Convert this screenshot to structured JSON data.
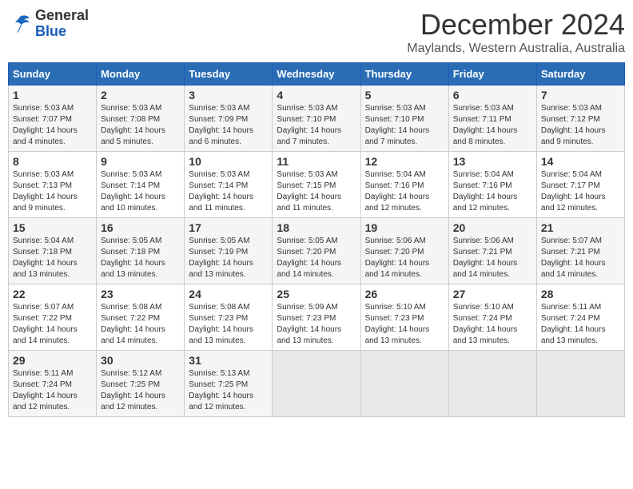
{
  "header": {
    "logo_line1": "General",
    "logo_line2": "Blue",
    "month": "December 2024",
    "location": "Maylands, Western Australia, Australia"
  },
  "weekdays": [
    "Sunday",
    "Monday",
    "Tuesday",
    "Wednesday",
    "Thursday",
    "Friday",
    "Saturday"
  ],
  "weeks": [
    [
      {
        "day": "1",
        "sunrise": "5:03 AM",
        "sunset": "7:07 PM",
        "daylight": "14 hours and 4 minutes."
      },
      {
        "day": "2",
        "sunrise": "5:03 AM",
        "sunset": "7:08 PM",
        "daylight": "14 hours and 5 minutes."
      },
      {
        "day": "3",
        "sunrise": "5:03 AM",
        "sunset": "7:09 PM",
        "daylight": "14 hours and 6 minutes."
      },
      {
        "day": "4",
        "sunrise": "5:03 AM",
        "sunset": "7:10 PM",
        "daylight": "14 hours and 7 minutes."
      },
      {
        "day": "5",
        "sunrise": "5:03 AM",
        "sunset": "7:10 PM",
        "daylight": "14 hours and 7 minutes."
      },
      {
        "day": "6",
        "sunrise": "5:03 AM",
        "sunset": "7:11 PM",
        "daylight": "14 hours and 8 minutes."
      },
      {
        "day": "7",
        "sunrise": "5:03 AM",
        "sunset": "7:12 PM",
        "daylight": "14 hours and 9 minutes."
      }
    ],
    [
      {
        "day": "8",
        "sunrise": "5:03 AM",
        "sunset": "7:13 PM",
        "daylight": "14 hours and 9 minutes."
      },
      {
        "day": "9",
        "sunrise": "5:03 AM",
        "sunset": "7:14 PM",
        "daylight": "14 hours and 10 minutes."
      },
      {
        "day": "10",
        "sunrise": "5:03 AM",
        "sunset": "7:14 PM",
        "daylight": "14 hours and 11 minutes."
      },
      {
        "day": "11",
        "sunrise": "5:03 AM",
        "sunset": "7:15 PM",
        "daylight": "14 hours and 11 minutes."
      },
      {
        "day": "12",
        "sunrise": "5:04 AM",
        "sunset": "7:16 PM",
        "daylight": "14 hours and 12 minutes."
      },
      {
        "day": "13",
        "sunrise": "5:04 AM",
        "sunset": "7:16 PM",
        "daylight": "14 hours and 12 minutes."
      },
      {
        "day": "14",
        "sunrise": "5:04 AM",
        "sunset": "7:17 PM",
        "daylight": "14 hours and 12 minutes."
      }
    ],
    [
      {
        "day": "15",
        "sunrise": "5:04 AM",
        "sunset": "7:18 PM",
        "daylight": "14 hours and 13 minutes."
      },
      {
        "day": "16",
        "sunrise": "5:05 AM",
        "sunset": "7:18 PM",
        "daylight": "14 hours and 13 minutes."
      },
      {
        "day": "17",
        "sunrise": "5:05 AM",
        "sunset": "7:19 PM",
        "daylight": "14 hours and 13 minutes."
      },
      {
        "day": "18",
        "sunrise": "5:05 AM",
        "sunset": "7:20 PM",
        "daylight": "14 hours and 14 minutes."
      },
      {
        "day": "19",
        "sunrise": "5:06 AM",
        "sunset": "7:20 PM",
        "daylight": "14 hours and 14 minutes."
      },
      {
        "day": "20",
        "sunrise": "5:06 AM",
        "sunset": "7:21 PM",
        "daylight": "14 hours and 14 minutes."
      },
      {
        "day": "21",
        "sunrise": "5:07 AM",
        "sunset": "7:21 PM",
        "daylight": "14 hours and 14 minutes."
      }
    ],
    [
      {
        "day": "22",
        "sunrise": "5:07 AM",
        "sunset": "7:22 PM",
        "daylight": "14 hours and 14 minutes."
      },
      {
        "day": "23",
        "sunrise": "5:08 AM",
        "sunset": "7:22 PM",
        "daylight": "14 hours and 14 minutes."
      },
      {
        "day": "24",
        "sunrise": "5:08 AM",
        "sunset": "7:23 PM",
        "daylight": "14 hours and 13 minutes."
      },
      {
        "day": "25",
        "sunrise": "5:09 AM",
        "sunset": "7:23 PM",
        "daylight": "14 hours and 13 minutes."
      },
      {
        "day": "26",
        "sunrise": "5:10 AM",
        "sunset": "7:23 PM",
        "daylight": "14 hours and 13 minutes."
      },
      {
        "day": "27",
        "sunrise": "5:10 AM",
        "sunset": "7:24 PM",
        "daylight": "14 hours and 13 minutes."
      },
      {
        "day": "28",
        "sunrise": "5:11 AM",
        "sunset": "7:24 PM",
        "daylight": "14 hours and 13 minutes."
      }
    ],
    [
      {
        "day": "29",
        "sunrise": "5:11 AM",
        "sunset": "7:24 PM",
        "daylight": "14 hours and 12 minutes."
      },
      {
        "day": "30",
        "sunrise": "5:12 AM",
        "sunset": "7:25 PM",
        "daylight": "14 hours and 12 minutes."
      },
      {
        "day": "31",
        "sunrise": "5:13 AM",
        "sunset": "7:25 PM",
        "daylight": "14 hours and 12 minutes."
      },
      null,
      null,
      null,
      null
    ]
  ],
  "labels": {
    "sunrise": "Sunrise:",
    "sunset": "Sunset:",
    "daylight": "Daylight hours"
  }
}
